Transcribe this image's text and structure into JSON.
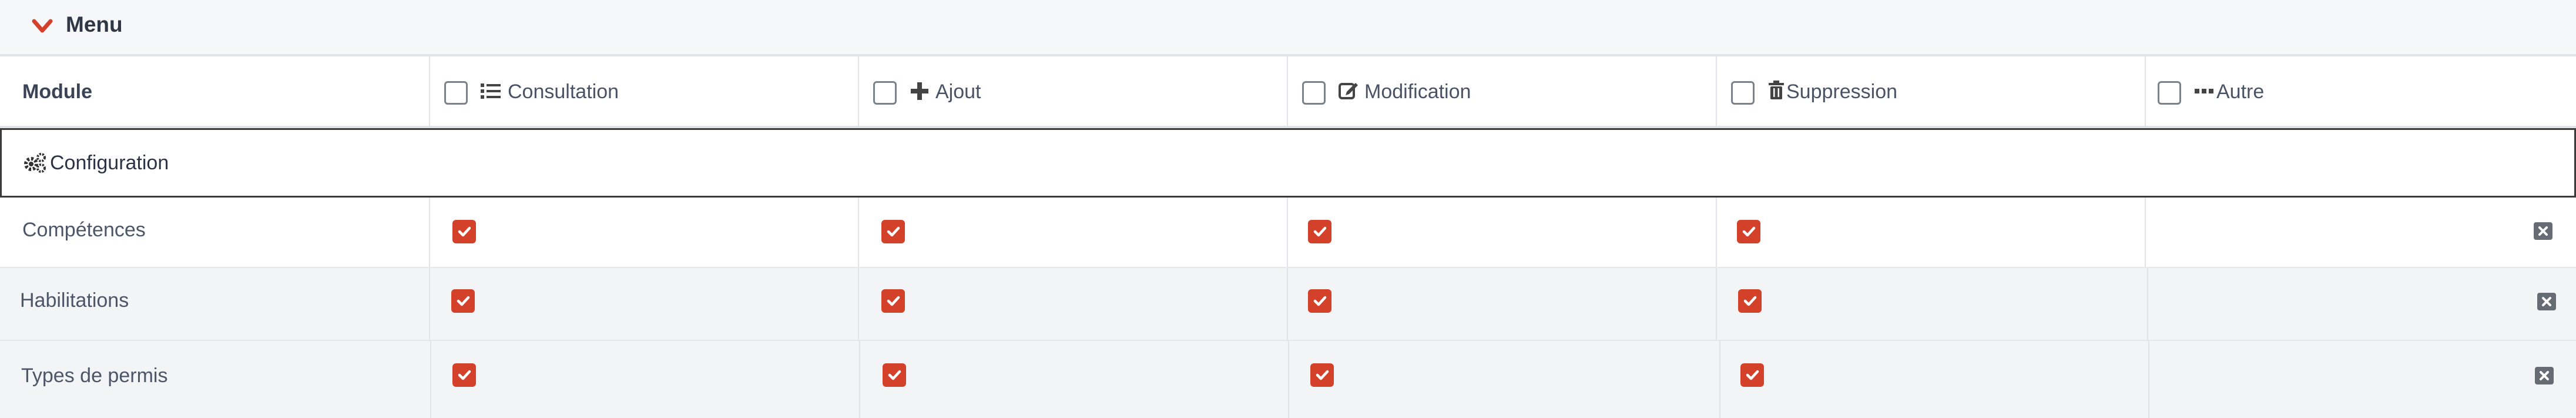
{
  "menu": {
    "title": "Menu"
  },
  "columns": {
    "module": "Module",
    "consultation": "Consultation",
    "ajout": "Ajout",
    "modification": "Modification",
    "suppression": "Suppression",
    "autre": "Autre"
  },
  "group": {
    "label": "Configuration",
    "icon": "cogs-icon"
  },
  "rows": [
    {
      "label": "Compétences",
      "consultation": true,
      "ajout": true,
      "modification": true,
      "suppression": true,
      "autre": false
    },
    {
      "label": "Habilitations",
      "consultation": true,
      "ajout": true,
      "modification": true,
      "suppression": true,
      "autre": false
    },
    {
      "label": "Types de permis",
      "consultation": true,
      "ajout": true,
      "modification": true,
      "suppression": true,
      "autre": false
    }
  ],
  "colors": {
    "accent": "#d4412b",
    "header_bg": "#f6f7f8",
    "row_alt_bg": "#f2f4f6",
    "remove_badge": "#676c74"
  }
}
